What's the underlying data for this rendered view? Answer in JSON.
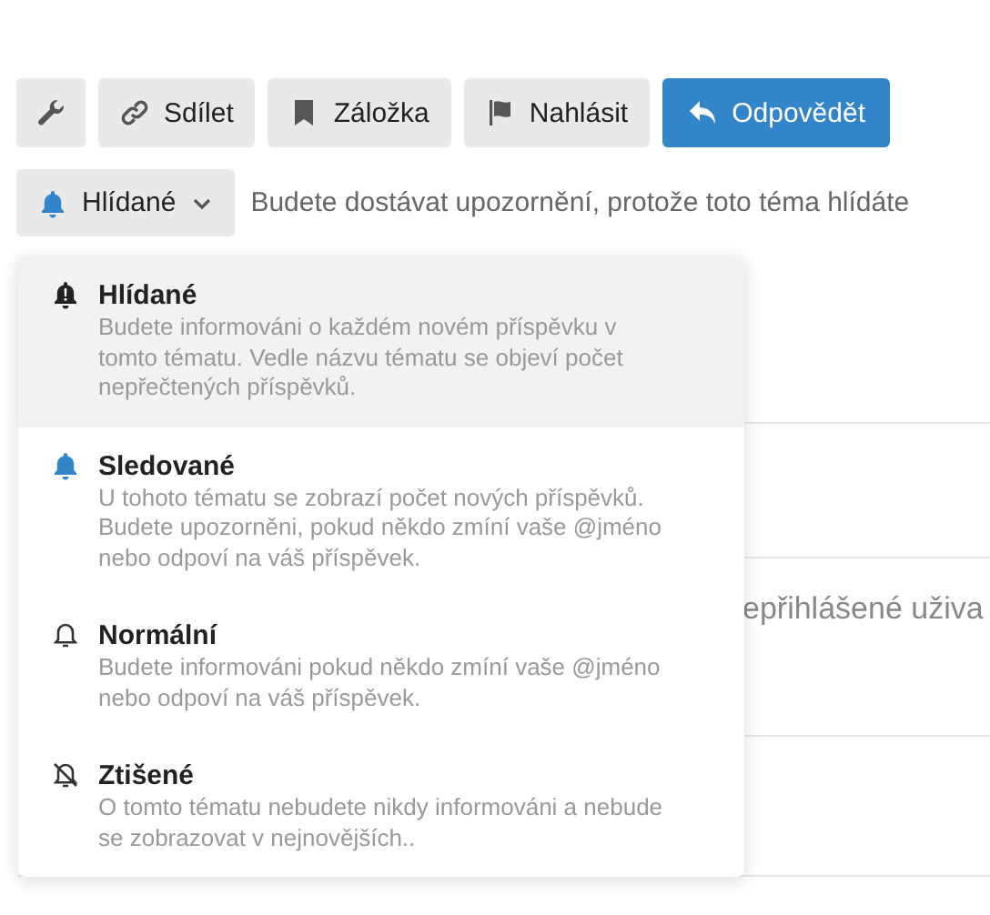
{
  "toolbar": [
    {
      "kind": "icon"
    },
    {
      "kind": "default",
      "label": "Sdílet"
    },
    {
      "kind": "default",
      "label": "Záložka"
    },
    {
      "kind": "default",
      "label": "Nahlásit"
    },
    {
      "kind": "primary",
      "label": "Odpovědět"
    }
  ],
  "notification": {
    "label": "Hlídané",
    "expanded": true,
    "reason": "Budete dostávat upozornění, protože toto téma hlídáte"
  },
  "menu": [
    {
      "title": "Hlídané",
      "description": "Budete informováni o každém novém příspěvku v tomto tématu. Vedle názvu tématu se objeví počet nepřečtených příspěvků.",
      "selected": true
    },
    {
      "title": "Sledované",
      "description": "U tohoto tématu se zobrazí počet nových příspěvků. Budete upozorněni, pokud někdo zmíní vaše @jméno nebo odpoví na váš příspěvek.",
      "selected": false
    },
    {
      "title": "Normální",
      "description": "Budete informováni pokud někdo zmíní vaše @jméno nebo odpoví na váš příspěvek.",
      "selected": false
    },
    {
      "title": "Ztišené",
      "description": "O tomto tématu nebudete nikdy informováni a nebude se zobrazovat v nejnovějších..",
      "selected": false
    }
  ],
  "background_text": "epřihlášené uživa"
}
